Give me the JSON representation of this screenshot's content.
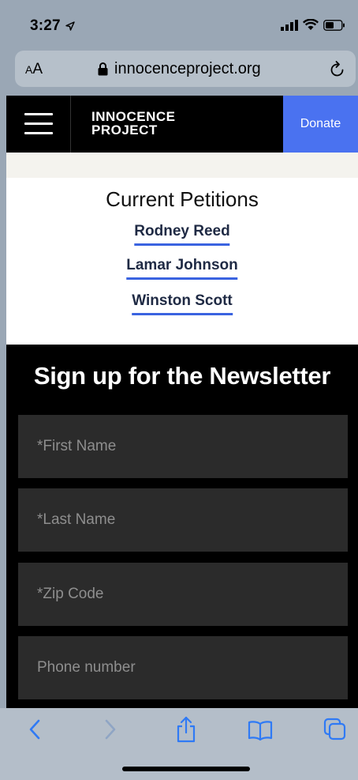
{
  "status_bar": {
    "time": "3:27"
  },
  "browser": {
    "text_size_label_small": "A",
    "text_size_label_large": "A",
    "url": "innocenceproject.org"
  },
  "site_header": {
    "logo_line1": "INNOCENCE",
    "logo_line2": "PROJECT",
    "donate_label": "Donate",
    "donate_color": "#4a72f0"
  },
  "petitions": {
    "title": "Current Petitions",
    "links": [
      "Rodney Reed",
      "Lamar Johnson",
      "Winston Scott"
    ],
    "underline_color": "#3a63e0"
  },
  "newsletter": {
    "title": "Sign up for the Newsletter",
    "fields": [
      {
        "placeholder": "*First Name",
        "value": ""
      },
      {
        "placeholder": "*Last Name",
        "value": ""
      },
      {
        "placeholder": "*Zip Code",
        "value": ""
      },
      {
        "placeholder": "Phone number",
        "value": ""
      }
    ]
  },
  "toolbar": {
    "icons": [
      "back-icon",
      "forward-icon",
      "share-icon",
      "bookmarks-icon",
      "tabs-icon"
    ],
    "accent": "#2f7af5"
  }
}
